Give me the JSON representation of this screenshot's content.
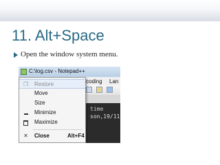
{
  "slide": {
    "title": "11. Alt+Space",
    "bullet": "Open the window system menu."
  },
  "screenshot": {
    "window_title": "C:\\log.csv - Notepad++",
    "menubar_fragments": [
      "coding",
      "Lan"
    ],
    "editor_lines": [
      "time",
      "son,19/11/"
    ],
    "system_menu": {
      "items": [
        {
          "label": "Restore",
          "icon": "restore-icon",
          "enabled": false
        },
        {
          "label": "Move",
          "icon": "",
          "enabled": true
        },
        {
          "label": "Size",
          "icon": "",
          "enabled": true
        },
        {
          "label": "Minimize",
          "icon": "minimize-icon",
          "enabled": true
        },
        {
          "label": "Maximize",
          "icon": "maximize-icon",
          "enabled": true
        },
        {
          "label": "Close",
          "icon": "close-icon",
          "enabled": true,
          "shortcut": "Alt+F4"
        }
      ]
    }
  },
  "colors": {
    "title": "#2a6a86",
    "menu_highlight": "#e6eef9",
    "editor_bg": "#2b2b2b"
  }
}
